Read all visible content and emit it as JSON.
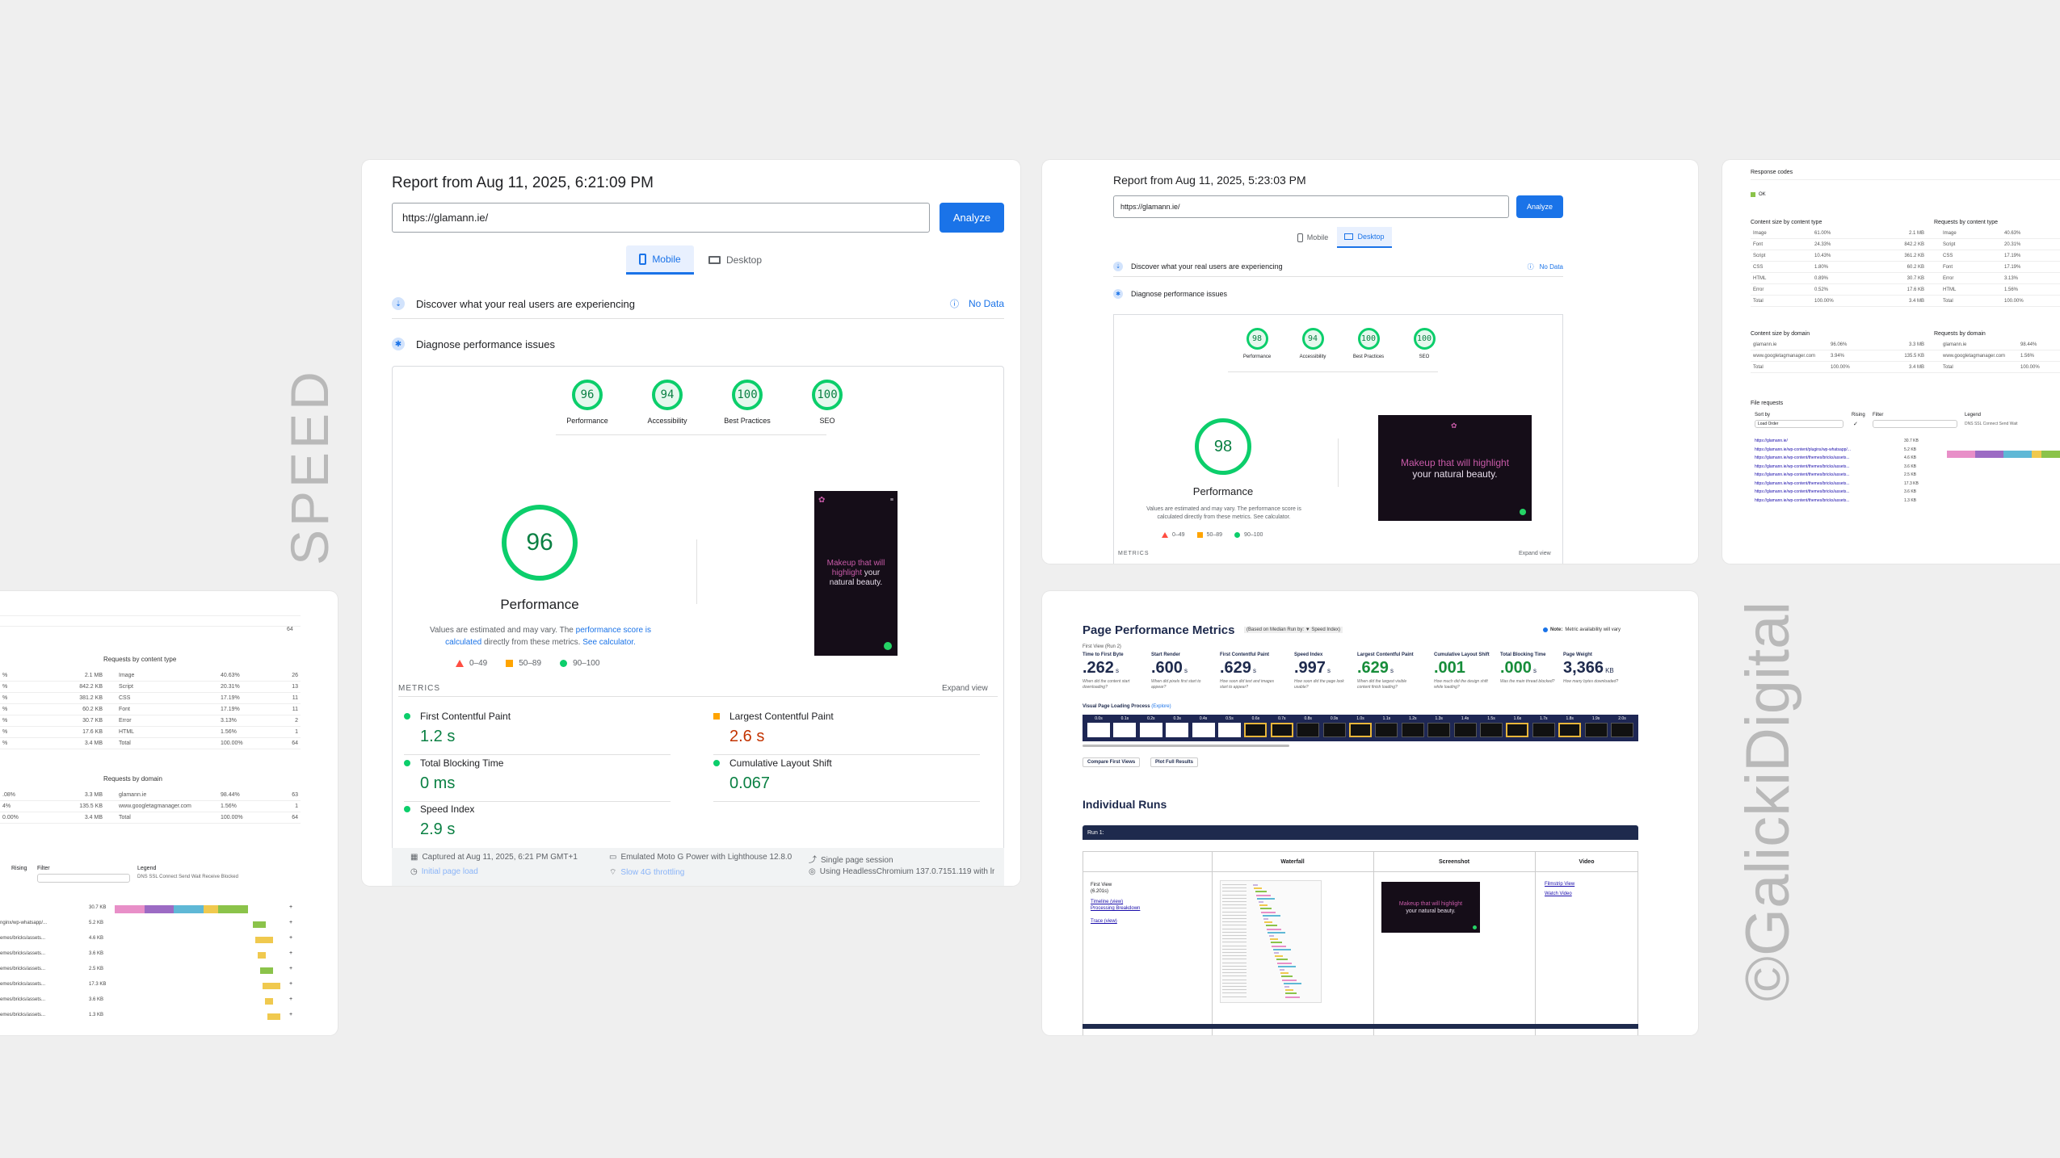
{
  "brand": {
    "side_left": "SPEED",
    "side_right": "©GalickiDigital"
  },
  "mobile_report": {
    "title": "Report from Aug 11, 2025, 6:21:09 PM",
    "url": "https://glamann.ie/",
    "analyze": "Analyze",
    "tabs": [
      "Mobile",
      "Desktop"
    ],
    "discover": "Discover what your real users are experiencing",
    "no_data": "No Data",
    "diagnose": "Diagnose performance issues",
    "scores": [
      {
        "value": "96",
        "label": "Performance"
      },
      {
        "value": "94",
        "label": "Accessibility"
      },
      {
        "value": "100",
        "label": "Best Practices"
      },
      {
        "value": "100",
        "label": "SEO"
      }
    ],
    "big_score": "96",
    "big_label": "Performance",
    "note_a": "Values are estimated and may vary. The ",
    "note_link1": "performance score is calculated",
    "note_b": " directly from these metrics. ",
    "note_link2": "See calculator.",
    "legend": [
      "0–49",
      "50–89",
      "90–100"
    ],
    "metrics_title": "METRICS",
    "expand": "Expand view",
    "metrics": [
      {
        "name": "First Contentful Paint",
        "value": "1.2 s"
      },
      {
        "name": "Largest Contentful Paint",
        "value": "2.6 s"
      },
      {
        "name": "Total Blocking Time",
        "value": "0 ms"
      },
      {
        "name": "Cumulative Layout Shift",
        "value": "0.067"
      },
      {
        "name": "Speed Index",
        "value": "2.9 s"
      }
    ],
    "footer": [
      "Captured at Aug 11, 2025, 6:21 PM GMT+1",
      "Emulated Moto G Power with Lighthouse 12.8.0",
      "Single page session",
      "Initial page load",
      "Slow 4G throttling",
      "Using HeadlessChromium 137.0.7151.119 with lr"
    ],
    "shot_text_a": "Makeup that will highlight",
    "shot_text_b": "your natural beauty."
  },
  "desktop_report": {
    "title": "Report from Aug 11, 2025, 5:23:03 PM",
    "url": "https://glamann.ie/",
    "analyze": "Analyze",
    "tabs": [
      "Mobile",
      "Desktop"
    ],
    "discover": "Discover what your real users are experiencing",
    "no_data": "No Data",
    "diagnose": "Diagnose performance issues",
    "scores": [
      {
        "value": "98",
        "label": "Performance"
      },
      {
        "value": "94",
        "label": "Accessibility"
      },
      {
        "value": "100",
        "label": "Best Practices"
      },
      {
        "value": "100",
        "label": "SEO"
      }
    ],
    "big_score": "98",
    "big_label": "Performance",
    "note": "Values are estimated and may vary. The performance score is calculated directly from these metrics. See calculator.",
    "legend": [
      "0–49",
      "50–89",
      "90–100"
    ],
    "metrics_title": "METRICS",
    "expand": "Expand view",
    "shot_text_a": "Makeup that will highlight",
    "shot_text_b": "your natural beauty."
  },
  "left_panel": {
    "section1": "Requests by content type",
    "rows1": [
      {
        "pct": "%",
        "size": "2.1 MB",
        "type": "Image",
        "pct2": "40.63%",
        "n": "26"
      },
      {
        "pct": "%",
        "size": "842.2 KB",
        "type": "Script",
        "pct2": "20.31%",
        "n": "13"
      },
      {
        "pct": "%",
        "size": "381.2 KB",
        "type": "CSS",
        "pct2": "17.19%",
        "n": "11"
      },
      {
        "pct": "%",
        "size": "60.2 KB",
        "type": "Font",
        "pct2": "17.19%",
        "n": "11"
      },
      {
        "pct": "%",
        "size": "30.7 KB",
        "type": "Error",
        "pct2": "3.13%",
        "n": "2"
      },
      {
        "pct": "%",
        "size": "17.6 KB",
        "type": "HTML",
        "pct2": "1.56%",
        "n": "1"
      },
      {
        "pct": "%",
        "size": "3.4 MB",
        "type": "Total",
        "pct2": "100.00%",
        "n": "64"
      }
    ],
    "section2": "Requests by domain",
    "rows2": [
      {
        "pct": ".08%",
        "size": "3.3 MB",
        "type": "glamann.ie",
        "pct2": "98.44%",
        "n": "63"
      },
      {
        "pct": "4%",
        "size": "135.5 KB",
        "type": "www.googletagmanager.com",
        "pct2": "1.56%",
        "n": "1"
      },
      {
        "pct": "0.00%",
        "size": "3.4 MB",
        "type": "Total",
        "pct2": "100.00%",
        "n": "64"
      }
    ],
    "sort": "Rising",
    "filter": "Filter",
    "legend_label": "Legend",
    "legend_items": "DNS SSL Connect Send Wait Receive Blocked",
    "files": [
      {
        "name": "",
        "size": "30.7 KB"
      },
      {
        "name": "nginx/wp-whatsapp/...",
        "size": "5.2 KB"
      },
      {
        "name": "emes/bricks/assets...",
        "size": "4.6 KB"
      },
      {
        "name": "emes/bricks/assets...",
        "size": "3.6 KB"
      },
      {
        "name": "emes/bricks/assets...",
        "size": "2.5 KB"
      },
      {
        "name": "emes/bricks/assets...",
        "size": "17.3 KB"
      },
      {
        "name": "emes/bricks/assets...",
        "size": "3.6 KB"
      },
      {
        "name": "emes/bricks/assets...",
        "size": "1.3 KB"
      }
    ]
  },
  "right_panel": {
    "response_codes": "Response codes",
    "ok": "OK",
    "content_size": "Content size by content type",
    "requests_type": "Requests by content type",
    "types": [
      {
        "type": "Image",
        "pct": "61.00%",
        "size": "2.1 MB",
        "rtype": "Image",
        "rpct": "40.63%"
      },
      {
        "type": "Font",
        "pct": "24.33%",
        "size": "842.2 KB",
        "rtype": "Script",
        "rpct": "20.31%"
      },
      {
        "type": "Script",
        "pct": "10.43%",
        "size": "361.2 KB",
        "rtype": "CSS",
        "rpct": "17.19%"
      },
      {
        "type": "CSS",
        "pct": "1.80%",
        "size": "60.2 KB",
        "rtype": "Font",
        "rpct": "17.19%"
      },
      {
        "type": "HTML",
        "pct": "0.89%",
        "size": "30.7 KB",
        "rtype": "Error",
        "rpct": "3.13%"
      },
      {
        "type": "Error",
        "pct": "0.52%",
        "size": "17.6 KB",
        "rtype": "HTML",
        "rpct": "1.56%"
      },
      {
        "type": "Total",
        "pct": "100.00%",
        "size": "3.4 MB",
        "rtype": "Total",
        "rpct": "100.00%"
      }
    ],
    "content_domain": "Content size by domain",
    "requests_domain": "Requests by domain",
    "domains": [
      {
        "d": "glamann.ie",
        "pct": "96.06%",
        "size": "3.3 MB",
        "rd": "glamann.ie",
        "rpct": "98.44%"
      },
      {
        "d": "www.googletagmanager.com",
        "pct": "3.94%",
        "size": "135.5 KB",
        "rd": "www.googletagmanager.com",
        "rpct": "1.56%"
      },
      {
        "d": "Total",
        "pct": "100.00%",
        "size": "3.4 MB",
        "rd": "Total",
        "rpct": "100.00%"
      }
    ],
    "file_requests": "File requests",
    "sort_by": "Sort by",
    "sort_value": "Load Order",
    "rising": "Rising",
    "filter": "Filter",
    "legend": "Legend",
    "legend_items": "DNS SSL Connect Send Wait",
    "files": [
      {
        "name": "https://glamann.ie/",
        "size": "30.7 KB"
      },
      {
        "name": "https://glamann.ie/wp-content/plugins/wp-whatsapp/...",
        "size": "5.2 KB"
      },
      {
        "name": "https://glamann.ie/wp-content/themes/bricks/assets...",
        "size": "4.6 KB"
      },
      {
        "name": "https://glamann.ie/wp-content/themes/bricks/assets...",
        "size": "3.6 KB"
      },
      {
        "name": "https://glamann.ie/wp-content/themes/bricks/assets...",
        "size": "2.5 KB"
      },
      {
        "name": "https://glamann.ie/wp-content/themes/bricks/assets...",
        "size": "17.3 KB"
      },
      {
        "name": "https://glamann.ie/wp-content/themes/bricks/assets...",
        "size": "3.6 KB"
      },
      {
        "name": "https://glamann.ie/wp-content/themes/bricks/assets...",
        "size": "1.3 KB"
      }
    ]
  },
  "wpt": {
    "title": "Page Performance Metrics",
    "badge": "(Based on Median Run by: ▼ Speed Index)",
    "note_label": "Note:",
    "note": "Metric availability will vary",
    "first_view": "First View (Run 2)",
    "metrics": [
      {
        "label": "Time to First Byte",
        "value": ".262",
        "unit": "s",
        "desc": "When did the content start downloading?"
      },
      {
        "label": "Start Render",
        "value": ".600",
        "unit": "s",
        "desc": "When did pixels first start to appear?"
      },
      {
        "label": "First Contentful Paint",
        "value": ".629",
        "unit": "s",
        "desc": "How soon did text and images start to appear?"
      },
      {
        "label": "Speed Index",
        "value": ".997",
        "unit": "s",
        "desc": "How soon did the page look usable?"
      },
      {
        "label": "Largest Contentful Paint",
        "value": ".629",
        "unit": "s",
        "desc": "When did the largest visible content finish loading?"
      },
      {
        "label": "Cumulative Layout Shift",
        "value": ".001",
        "unit": "",
        "desc": "How much did the design shift while loading?"
      },
      {
        "label": "Total Blocking Time",
        "value": ".000",
        "unit": "s",
        "desc": "Was the main thread blocked?"
      },
      {
        "label": "Page Weight",
        "value": "3,366",
        "unit": "KB",
        "desc": "How many bytes downloaded?"
      }
    ],
    "visual": "Visual Page Loading Process",
    "explore": "(Explore)",
    "frame_times": [
      "0.0s",
      "0.1s",
      "0.2s",
      "0.3s",
      "0.4s",
      "0.5s",
      "0.6s",
      "0.7s",
      "0.8s",
      "0.9s",
      "1.0s",
      "1.1s",
      "1.2s",
      "1.3s",
      "1.4s",
      "1.5s",
      "1.6s",
      "1.7s",
      "1.8s",
      "1.9s",
      "2.0s"
    ],
    "compare": "Compare First Views",
    "plot": "Plot Full Results",
    "individual": "Individual Runs",
    "run": "Run 1:",
    "cols": [
      "Waterfall",
      "Screenshot",
      "Video"
    ],
    "first_view_label": "First View",
    "first_view_time": "(6.201s)",
    "links": [
      "Timeline (view)",
      "Processing Breakdown",
      "Trace (view)"
    ],
    "video_links": [
      "Filmstrip View",
      "Watch Video"
    ],
    "shot_text_a": "Makeup that will highlight",
    "shot_text_b": "your natural beauty."
  },
  "colors": {
    "good": "#0cce6b",
    "avg": "#ffa400",
    "poor": "#ff4e42",
    "accent": "#1a73e8",
    "navy": "#1e2a4d"
  }
}
